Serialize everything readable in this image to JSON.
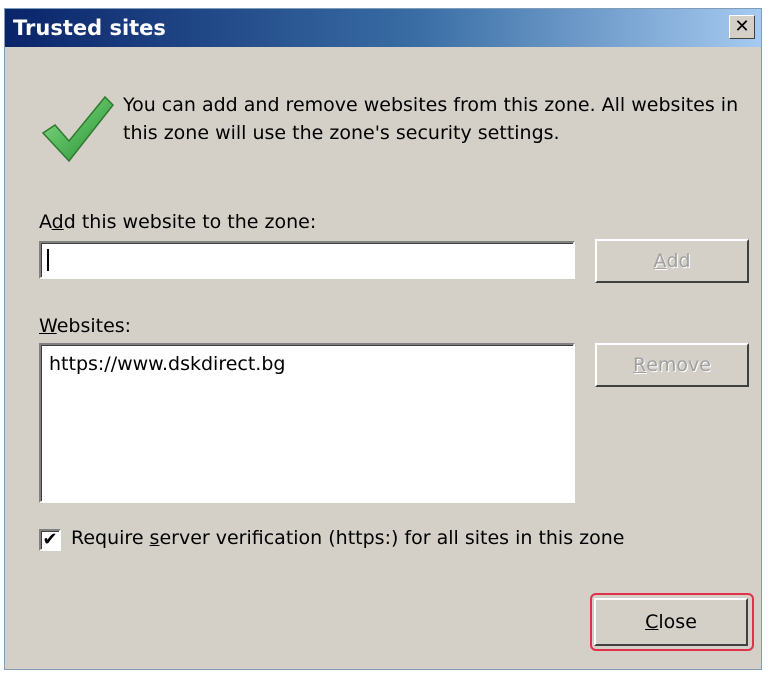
{
  "window": {
    "title": "Trusted sites",
    "close_glyph": "✕"
  },
  "intro": {
    "icon": "green-checkmark-icon",
    "text": "You can add and remove websites from this zone. All websites in this zone will use the zone's security settings."
  },
  "add_section": {
    "label_prefix": "A",
    "label_accel": "d",
    "label_rest": "d this website to the zone:",
    "input_value": "",
    "add_button_accel": "A",
    "add_button_rest": "dd"
  },
  "websites_section": {
    "label_accel": "W",
    "label_rest": "ebsites:",
    "sites": [
      "https://www.dskdirect.bg"
    ],
    "remove_button_accel": "R",
    "remove_button_rest": "emove"
  },
  "verification": {
    "checked": true,
    "label_prefix": "Require ",
    "label_accel": "s",
    "label_rest": "erver verification (https:) for all sites in this zone"
  },
  "footer": {
    "close_accel": "C",
    "close_rest": "lose"
  },
  "colors": {
    "dialog_bg": "#d4d0c8",
    "title_bar_start": "#0a246a",
    "highlight": "#e0304a"
  }
}
